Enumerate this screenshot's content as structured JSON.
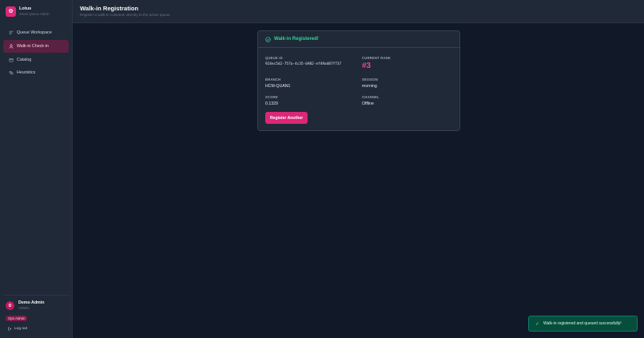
{
  "brand": {
    "name": "Lotus",
    "subtitle": "Smart Queue Admin"
  },
  "nav": {
    "items": [
      {
        "label": "Queue Workspace",
        "icon": "list-icon"
      },
      {
        "label": "Walk-in Check-in",
        "icon": "user-icon",
        "active": true
      },
      {
        "label": "Catalog",
        "icon": "box-icon"
      },
      {
        "label": "Heuristics",
        "icon": "sliders-icon"
      }
    ]
  },
  "user": {
    "initial": "D",
    "name": "Demo Admin",
    "email": "ADMIN",
    "role": "Ops Admin",
    "logout_label": "Log out"
  },
  "header": {
    "title": "Walk-in Registration",
    "subtitle": "Register a walk-in customer directly to the active queue"
  },
  "result": {
    "title": "Walk-in Registered!",
    "queue_id_label": "QUEUE ID",
    "queue_id": "924ec5d2-757a-4c35-b982-ef49a487f737",
    "rank_label": "CURRENT RANK",
    "rank": "#3",
    "branch_label": "BRANCH",
    "branch": "HCM-QUAN1",
    "session_label": "SESSION",
    "session": "morning",
    "score_label": "SCORE",
    "score": "0.1329",
    "channel_label": "CHANNEL",
    "channel": "Offline",
    "button_label": "Register Another"
  },
  "toast": {
    "icon": "✓",
    "message": "Walk-in registered and queued successfully!"
  },
  "colors": {
    "accent": "#db2777",
    "success": "#34d399",
    "background": "#111827",
    "panel": "#1f2937"
  }
}
